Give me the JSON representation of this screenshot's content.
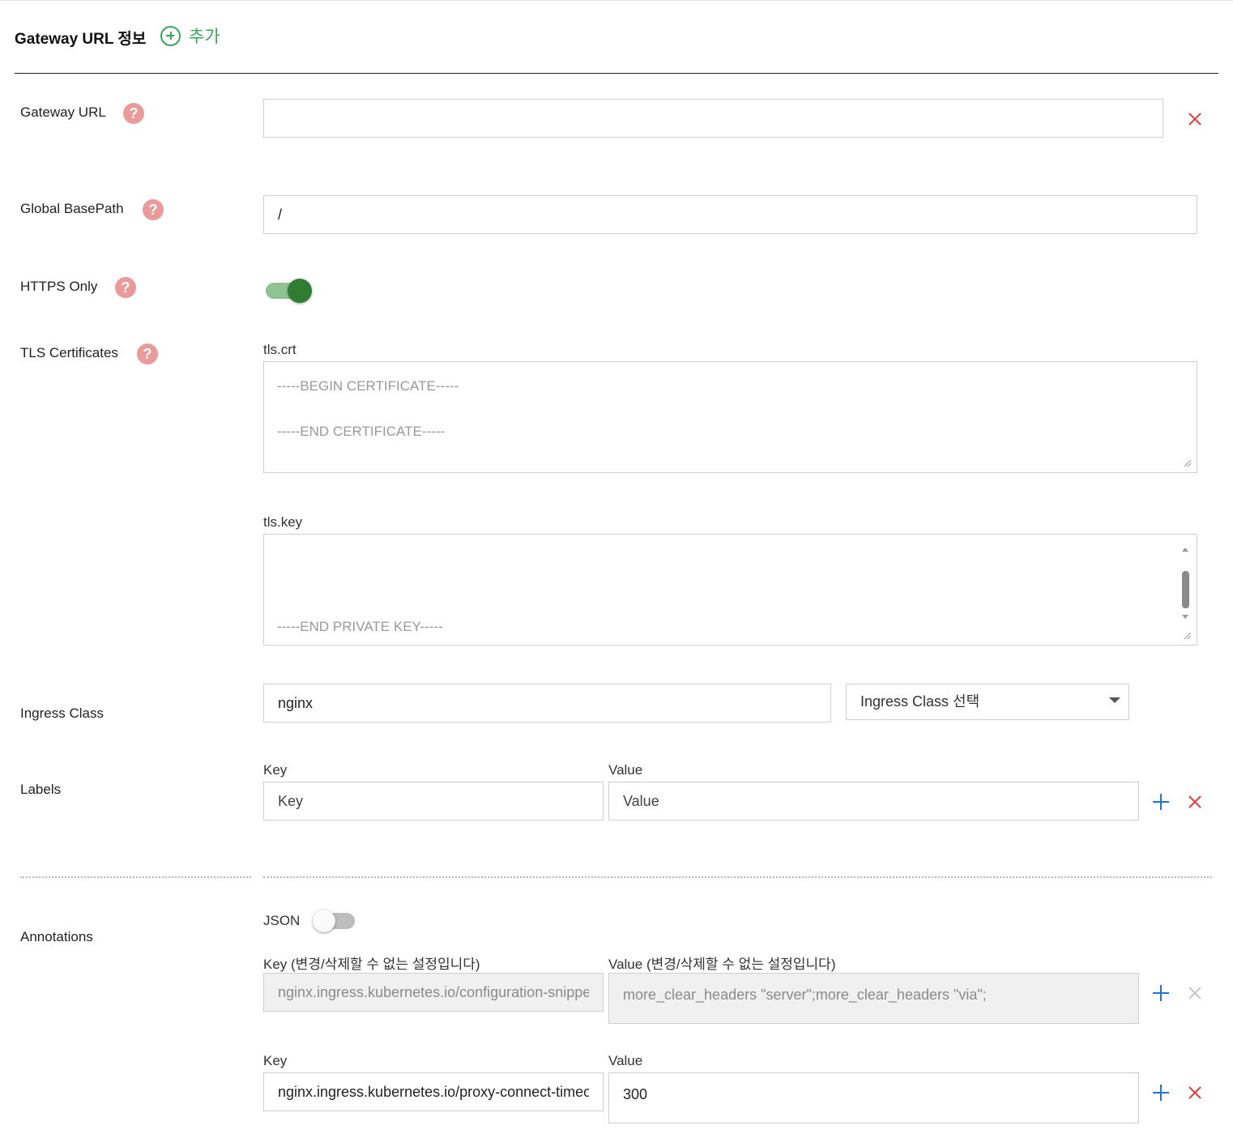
{
  "header": {
    "title": "Gateway URL 정보",
    "add_label": "추가"
  },
  "gateway_url": {
    "label": "Gateway URL",
    "value": "",
    "help": "?"
  },
  "global_base_path": {
    "label": "Global BasePath",
    "value": "/",
    "help": "?"
  },
  "https_only": {
    "label": "HTTPS Only",
    "enabled": true,
    "help": "?"
  },
  "tls": {
    "label": "TLS Certificates",
    "help": "?",
    "crt_label": "tls.crt",
    "crt_value": "-----BEGIN CERTIFICATE-----\n\n-----END CERTIFICATE-----",
    "key_label": "tls.key",
    "key_value": "\n\n\n-----END PRIVATE KEY-----"
  },
  "ingress_class": {
    "label": "Ingress Class",
    "value": "nginx",
    "select_placeholder": "Ingress Class 선택"
  },
  "labels": {
    "label": "Labels",
    "key_header": "Key",
    "value_header": "Value",
    "key_placeholder": "Key",
    "value_placeholder": "Value"
  },
  "annotations": {
    "label": "Annotations",
    "json_toggle_label": "JSON",
    "json_enabled": false,
    "rows": [
      {
        "key_header": "Key  (변경/삭제할 수 없는 설정입니다)",
        "value_header": "Value  (변경/삭제할 수 없는 설정입니다)",
        "key": "nginx.ingress.kubernetes.io/configuration-snippet",
        "value": "more_clear_headers \"server\";more_clear_headers \"via\";",
        "locked": true
      },
      {
        "key_header": "Key",
        "value_header": "Value",
        "key": "nginx.ingress.kubernetes.io/proxy-connect-timeout",
        "value": "300",
        "locked": false
      }
    ]
  }
}
